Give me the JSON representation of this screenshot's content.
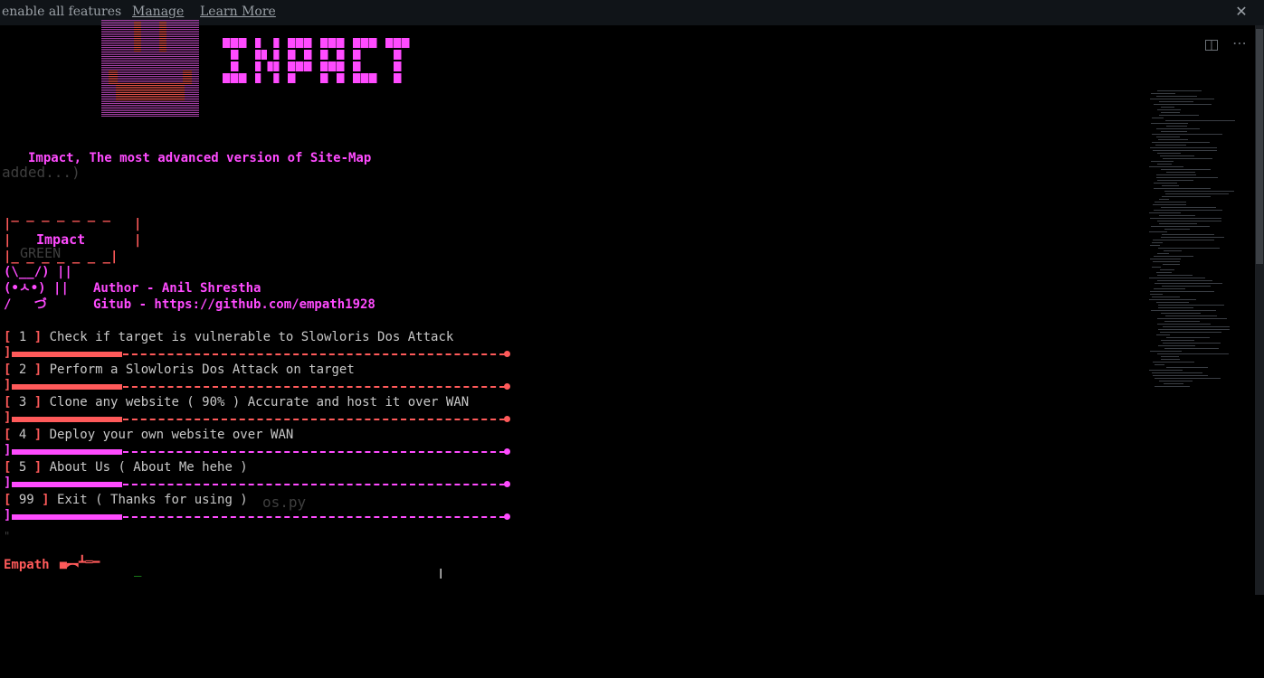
{
  "notification_bar": {
    "message": "enable all features",
    "manage_link": "Manage",
    "learn_more_link": "Learn More",
    "close_icon": "close-icon"
  },
  "editor_icons": [
    "split-editor-icon",
    "more-actions-icon"
  ],
  "ghost_text": {
    "added": "added...)",
    "green": "GREEN",
    "file": "os.py",
    "mark": "\""
  },
  "banner": {
    "title_art": "IMPACT",
    "tagline": "Impact, The most advanced version of Site-Map"
  },
  "box_art": {
    "top": " _ _ _ _ _ _ _",
    "left_top": "|",
    "right_top": "|",
    "label": "Impact",
    "bottom": "|_ _ _ _ _ _ _|",
    "face_line1": "(\\__/) ||",
    "face_line2": "(•ㅅ•) ||",
    "face_line3": "/   づ"
  },
  "author": {
    "author_line": "Author - Anil Shrestha",
    "github_line": "Gitub - https://github.com/empath1928"
  },
  "menu": [
    {
      "num": "1",
      "text": "Check if target is vulnerable to Slowloris Dos Attack"
    },
    {
      "num": "2",
      "text": "Perform a Slowloris Dos Attack on target"
    },
    {
      "num": "3",
      "text": "Clone any website ( 90% ) Accurate and host it over WAN"
    },
    {
      "num": "4",
      "text": "Deploy your own website over WAN"
    },
    {
      "num": "5",
      "text": "About Us ( About Me hehe )"
    },
    {
      "num": "99",
      "text": "Exit ( Thanks for using )"
    }
  ],
  "prompt": {
    "user": "Empath",
    "gun": "▄︻┻═━",
    "cursor": "_"
  },
  "colors": {
    "magenta": "#ff4bff",
    "red": "#ff5a5a",
    "face_red": "#e0504a",
    "face_purple": "#b040b0",
    "background": "#000000"
  }
}
